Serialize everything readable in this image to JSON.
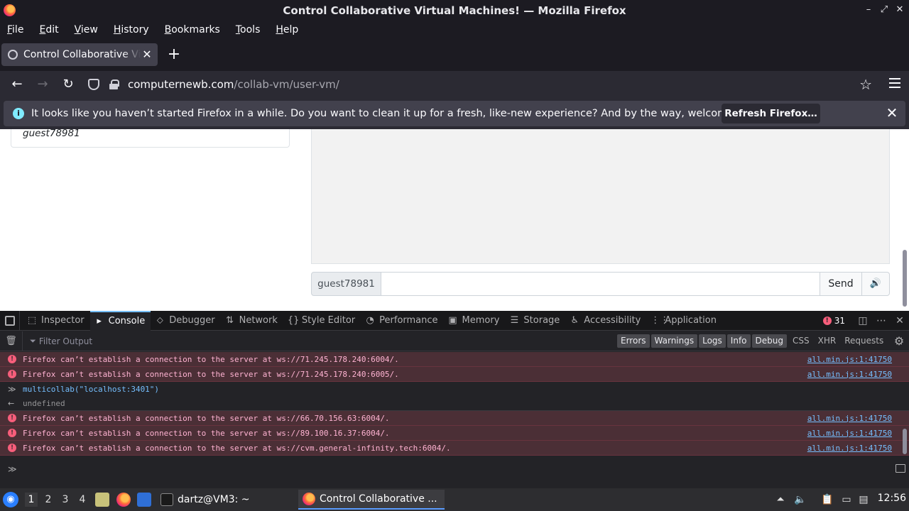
{
  "window": {
    "title": "Control Collaborative Virtual Machines! — Mozilla Firefox",
    "controls": [
      "–",
      "⤢",
      "✕"
    ]
  },
  "menubar": {
    "items": [
      "File",
      "Edit",
      "View",
      "History",
      "Bookmarks",
      "Tools",
      "Help"
    ]
  },
  "tabs": {
    "active_label": "Control Collaborative Virtual Machines!",
    "close_glyph": "✕",
    "new_tab_glyph": "+"
  },
  "navbar": {
    "back_glyph": "←",
    "forward_glyph": "→",
    "reload_glyph": "↻",
    "url_host": "computernewb.com",
    "url_path": "/collab-vm/user-vm/",
    "bookmark_glyph": "☆"
  },
  "notification": {
    "icon_glyph": "i",
    "text": "It looks like you haven’t started Firefox in a while. Do you want to clean it up for a fresh, like-new experience? And by the way, welcome back!",
    "button_label": "Refresh Firefox…",
    "close_glyph": "✕"
  },
  "page": {
    "userlist_name": "guest78981",
    "chat_username": "guest78981",
    "chat_placeholder": "",
    "send_label": "Send",
    "sound_glyph": "🔊"
  },
  "devtools": {
    "tabs": [
      {
        "label": "Inspector",
        "icon": "⬚"
      },
      {
        "label": "Console",
        "icon": "▸"
      },
      {
        "label": "Debugger",
        "icon": "⬦"
      },
      {
        "label": "Network",
        "icon": "⇅"
      },
      {
        "label": "Style Editor",
        "icon": "{}"
      },
      {
        "label": "Performance",
        "icon": "◔"
      },
      {
        "label": "Memory",
        "icon": "▣"
      },
      {
        "label": "Storage",
        "icon": "☰"
      },
      {
        "label": "Accessibility",
        "icon": "♿"
      },
      {
        "label": "Application",
        "icon": "⋮⋮"
      }
    ],
    "error_count": "31",
    "filter_placeholder": "Filter Output",
    "levels": [
      "Errors",
      "Warnings",
      "Logs",
      "Info",
      "Debug"
    ],
    "requests": [
      "CSS",
      "XHR",
      "Requests"
    ],
    "log": [
      {
        "kind": "error",
        "message": "Firefox can’t establish a connection to the server at ws://71.245.178.240:6004/.",
        "source": "all.min.js:1:41750"
      },
      {
        "kind": "error",
        "message": "Firefox can’t establish a connection to the server at ws://71.245.178.240:6005/.",
        "source": "all.min.js:1:41750"
      },
      {
        "kind": "input",
        "message": "multicollab(\"localhost:3401\")"
      },
      {
        "kind": "output",
        "message": "undefined"
      },
      {
        "kind": "error",
        "message": "Firefox can’t establish a connection to the server at ws://66.70.156.63:6004/.",
        "source": "all.min.js:1:41750"
      },
      {
        "kind": "error",
        "message": "Firefox can’t establish a connection to the server at ws://89.100.16.37:6004/.",
        "source": "all.min.js:1:41750"
      },
      {
        "kind": "error",
        "message": "Firefox can’t establish a connection to the server at ws://cvm.general-infinity.tech:6004/.",
        "source": "all.min.js:1:41750"
      }
    ],
    "prompt_glyph": "≫"
  },
  "taskbar": {
    "workspaces": [
      "1",
      "2",
      "3",
      "4"
    ],
    "active_workspace": "1",
    "terminal_task": "dartz@VM3: ~",
    "browser_task": "Control Collaborative ...",
    "clock": "12:56",
    "colors": {
      "accent": "#5a9cff",
      "firefox": "#ff7139"
    }
  }
}
